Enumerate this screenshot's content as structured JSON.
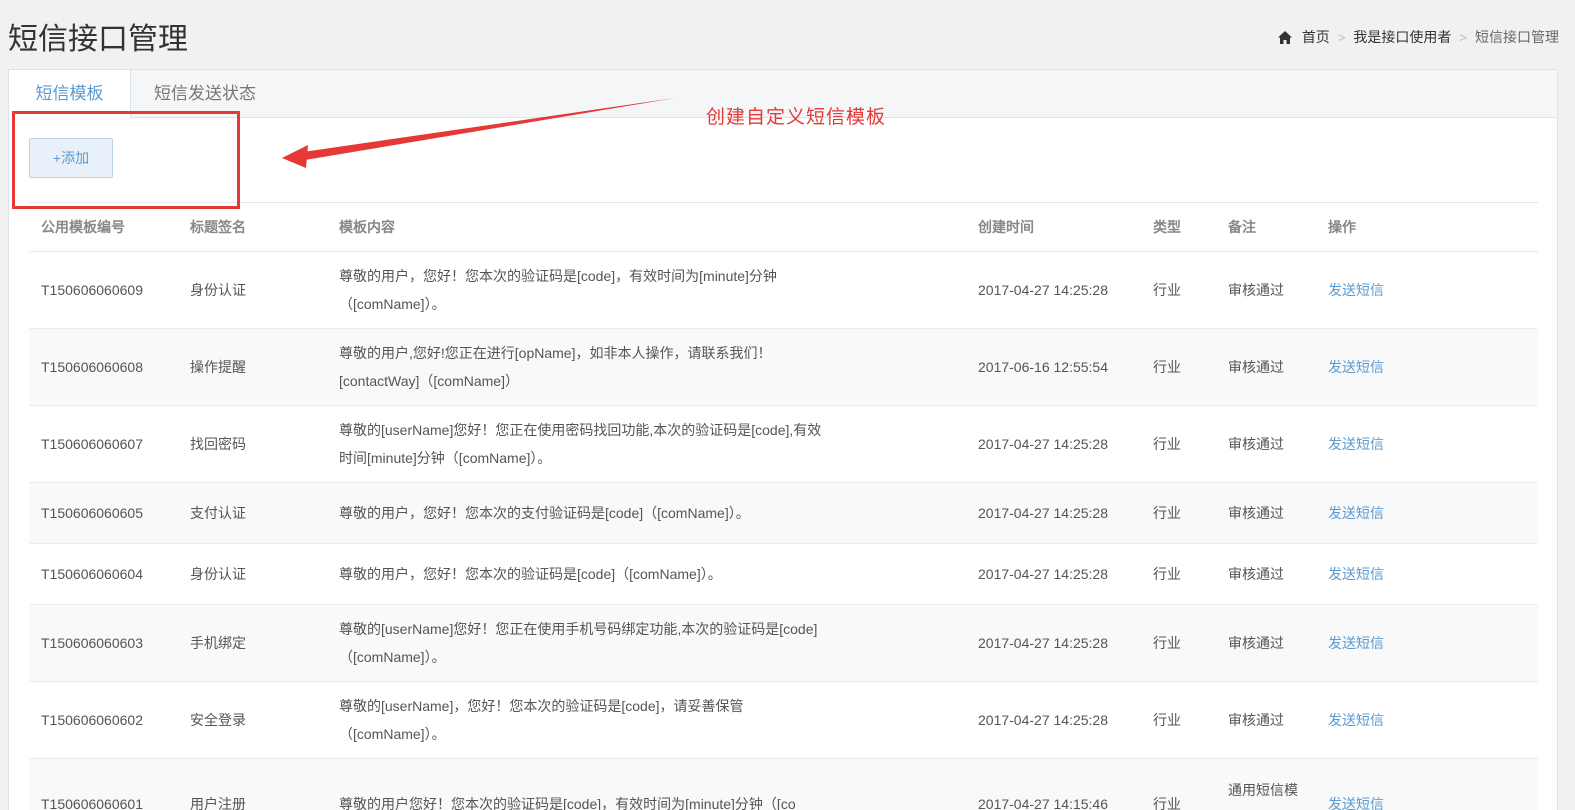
{
  "header": {
    "title": "短信接口管理",
    "breadcrumb": [
      "首页",
      "我是接口使用者",
      "短信接口管理"
    ]
  },
  "tabs": [
    {
      "label": "短信模板",
      "active": true
    },
    {
      "label": "短信发送状态",
      "active": false
    }
  ],
  "toolbar": {
    "add_label": "+添加"
  },
  "annotation": {
    "text": "创建自定义短信模板",
    "color": "#e53935"
  },
  "table": {
    "columns": [
      "公用模板编号",
      "标题签名",
      "模板内容",
      "创建时间",
      "类型",
      "备注",
      "操作"
    ],
    "rows": [
      {
        "id": "T150606060609",
        "title": "身份认证",
        "content": "尊敬的用户，您好！您本次的验证码是[code]，有效时间为[minute]分钟（[comName]）。",
        "time": "2017-04-27 14:25:28",
        "type": "行业",
        "remark": "审核通过",
        "action": "发送短信"
      },
      {
        "id": "T150606060608",
        "title": "操作提醒",
        "content": "尊敬的用户,您好!您正在进行[opName]，如非本人操作，请联系我们！[contactWay]（[comName]）",
        "time": "2017-06-16 12:55:54",
        "type": "行业",
        "remark": "审核通过",
        "action": "发送短信"
      },
      {
        "id": "T150606060607",
        "title": "找回密码",
        "content": "尊敬的[userName]您好！您正在使用密码找回功能,本次的验证码是[code],有效时间[minute]分钟（[comName]）。",
        "time": "2017-04-27 14:25:28",
        "type": "行业",
        "remark": "审核通过",
        "action": "发送短信"
      },
      {
        "id": "T150606060605",
        "title": "支付认证",
        "content": "尊敬的用户，您好！您本次的支付验证码是[code]（[comName]）。",
        "time": "2017-04-27 14:25:28",
        "type": "行业",
        "remark": "审核通过",
        "action": "发送短信"
      },
      {
        "id": "T150606060604",
        "title": "身份认证",
        "content": "尊敬的用户，您好！您本次的验证码是[code]（[comName]）。",
        "time": "2017-04-27 14:25:28",
        "type": "行业",
        "remark": "审核通过",
        "action": "发送短信"
      },
      {
        "id": "T150606060603",
        "title": "手机绑定",
        "content": "尊敬的[userName]您好！您正在使用手机号码绑定功能,本次的验证码是[code]（[comName]）。",
        "time": "2017-04-27 14:25:28",
        "type": "行业",
        "remark": "审核通过",
        "action": "发送短信"
      },
      {
        "id": "T150606060602",
        "title": "安全登录",
        "content": "尊敬的[userName]，您好！您本次的验证码是[code]，请妥善保管（[comName]）。",
        "time": "2017-04-27 14:25:28",
        "type": "行业",
        "remark": "审核通过",
        "action": "发送短信"
      },
      {
        "id": "T150606060601",
        "title": "用户注册",
        "content": "尊敬的用户您好！您本次的验证码是[code]，有效时间为[minute]分钟（[co",
        "time": "2017-04-27 14:15:46",
        "type": "行业",
        "remark": "通用短信模板，审核通",
        "action": "发送短信"
      }
    ]
  }
}
